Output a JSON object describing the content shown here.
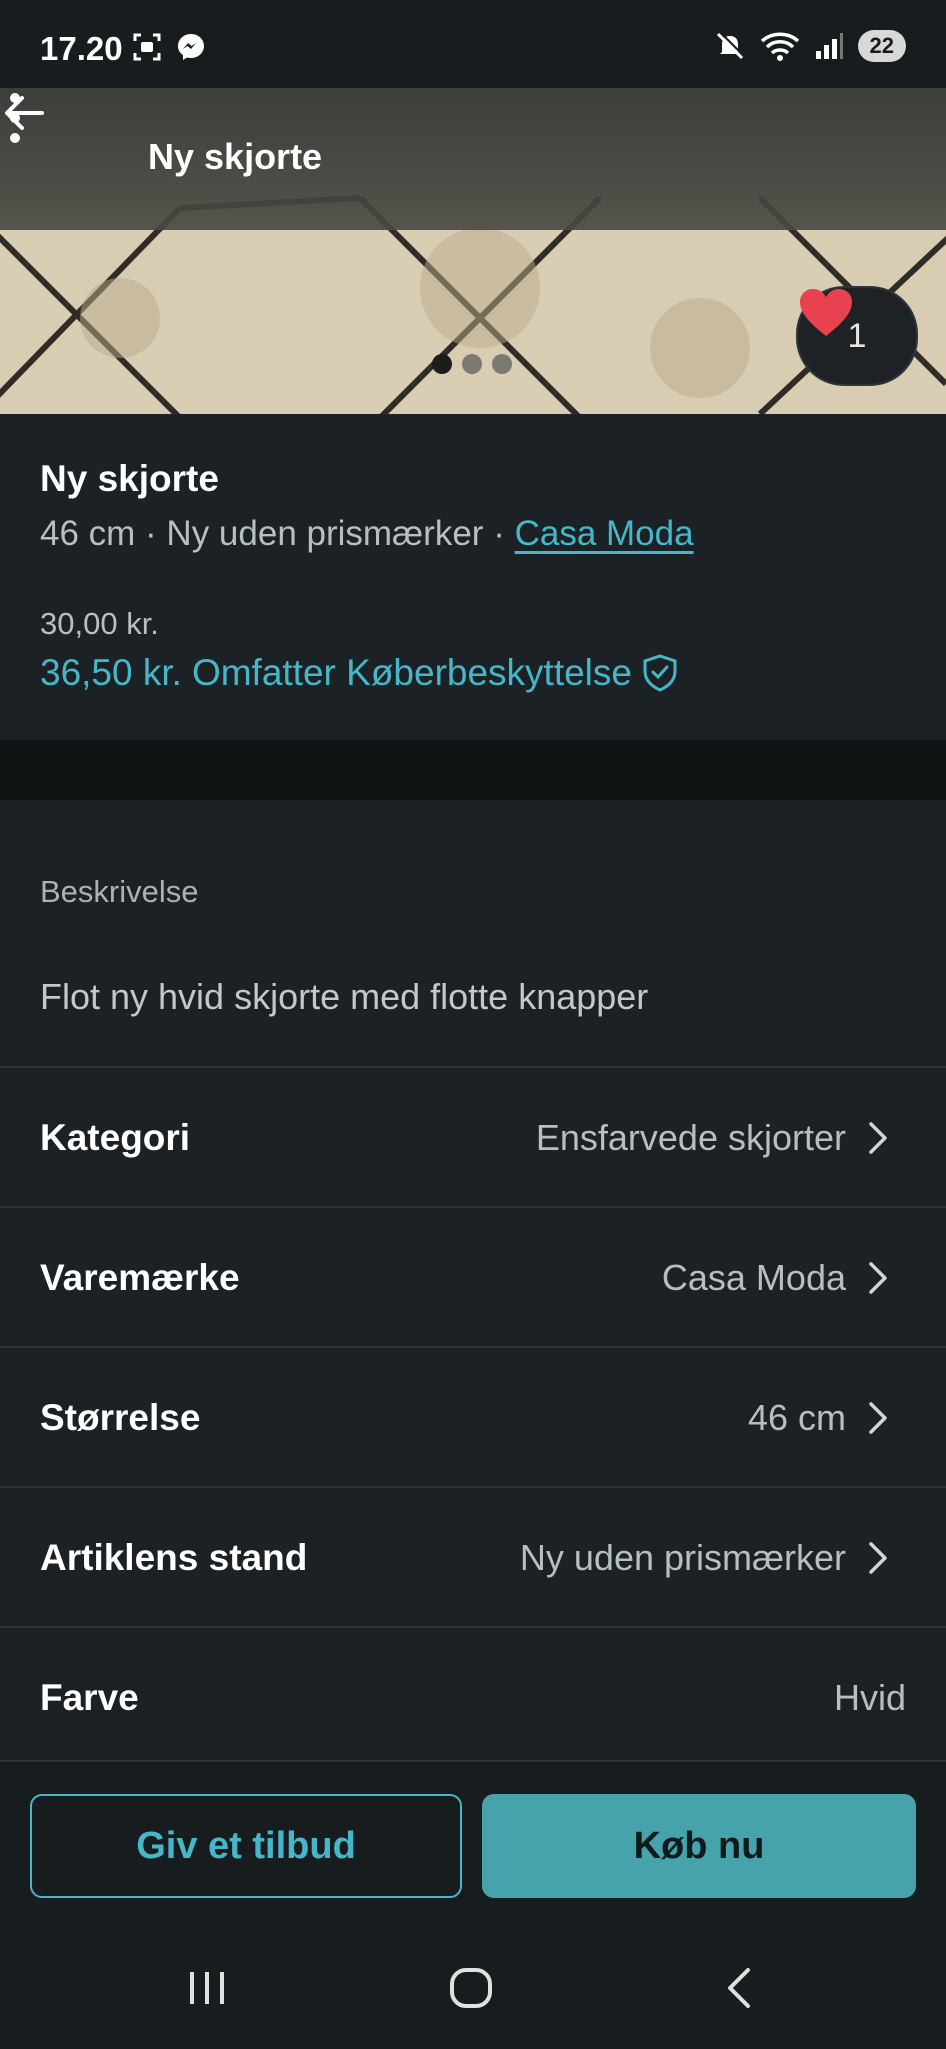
{
  "status_bar": {
    "time": "17.20",
    "battery": "22"
  },
  "header": {
    "title": "Ny skjorte"
  },
  "gallery": {
    "image_count": 3,
    "active_index": 0,
    "favorites_count": "1"
  },
  "item": {
    "title": "Ny skjorte",
    "size": "46 cm",
    "separator": " · ",
    "condition": "Ny uden prismærker",
    "brand": "Casa Moda",
    "price": "30,00 kr.",
    "price_total": "36,50 kr.",
    "protection_text": "Omfatter Køberbeskyttelse"
  },
  "description": {
    "label": "Beskrivelse",
    "text": "Flot ny hvid skjorte med flotte knapper"
  },
  "attributes": [
    {
      "name": "Kategori",
      "value": "Ensfarvede skjorter"
    },
    {
      "name": "Varemærke",
      "value": "Casa Moda"
    },
    {
      "name": "Størrelse",
      "value": "46 cm"
    },
    {
      "name": "Artiklens stand",
      "value": "Ny uden prismærker"
    },
    {
      "name": "Farve",
      "value": "Hvid"
    }
  ],
  "actions": {
    "offer_label": "Giv et tilbud",
    "buy_label": "Køb nu"
  },
  "colors": {
    "accent": "#46b7c8",
    "buy_button": "#46a2ab",
    "background": "#171d1f",
    "heart": "#e8414f"
  }
}
